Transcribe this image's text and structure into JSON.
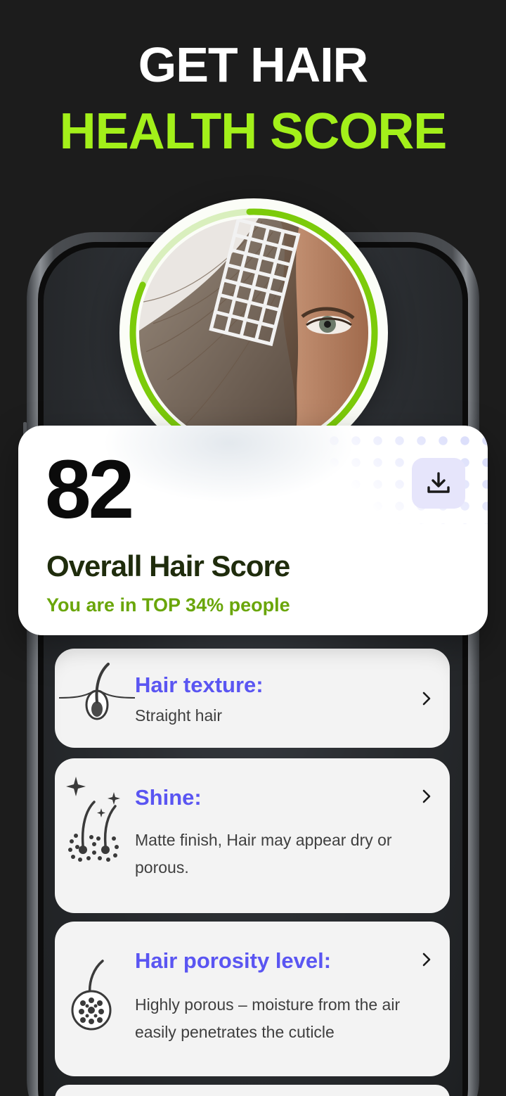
{
  "headline": {
    "line1": "GET HAIR",
    "line2": "HEALTH SCORE"
  },
  "score": {
    "value": "82",
    "title": "Overall Hair Score",
    "subtitle": "You are in TOP 34% people",
    "progress_fraction": 0.82
  },
  "colors": {
    "accent": "#a3f01a",
    "ring": "#7ccb0a",
    "title_purple": "#5a55f2",
    "subtitle_green": "#6aa60a"
  },
  "results": [
    {
      "title": "Hair texture:",
      "desc": "Straight hair",
      "icon": "hair-follicle-icon"
    },
    {
      "title": "Shine:",
      "desc": "Matte finish, Hair may appear dry or porous.",
      "icon": "shine-sparkle-icon"
    },
    {
      "title": "Hair porosity level:",
      "desc": "Highly porous – moisture from the air easily penetrates the cuticle",
      "icon": "porosity-icon"
    }
  ]
}
